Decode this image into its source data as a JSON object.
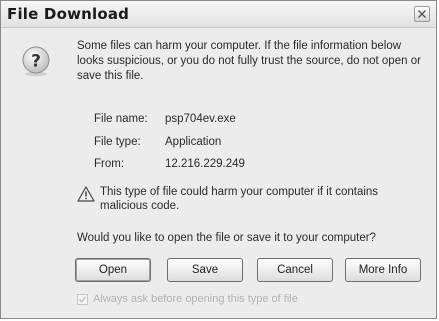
{
  "dialog": {
    "title": "File Download",
    "close_icon": "close-icon"
  },
  "icons": {
    "help": "question-mark-icon",
    "warning": "warning-triangle-icon"
  },
  "message": {
    "intro": "Some files can harm your computer. If the file information below looks suspicious, or you do not fully trust the source, do not open or save this file."
  },
  "file_info": [
    {
      "label": "File name:",
      "value": "psp704ev.exe"
    },
    {
      "label": "File type:",
      "value": "Application"
    },
    {
      "label": "From:",
      "value": "12.216.229.249"
    }
  ],
  "warning": {
    "text": "This type of file could harm your computer if it contains malicious code."
  },
  "question": "Would you like to open the file or save it to your computer?",
  "buttons": {
    "open": "Open",
    "save": "Save",
    "cancel": "Cancel",
    "more_info": "More Info"
  },
  "checkbox": {
    "label": "Always ask before opening this type of file",
    "checked": true,
    "disabled": true
  }
}
